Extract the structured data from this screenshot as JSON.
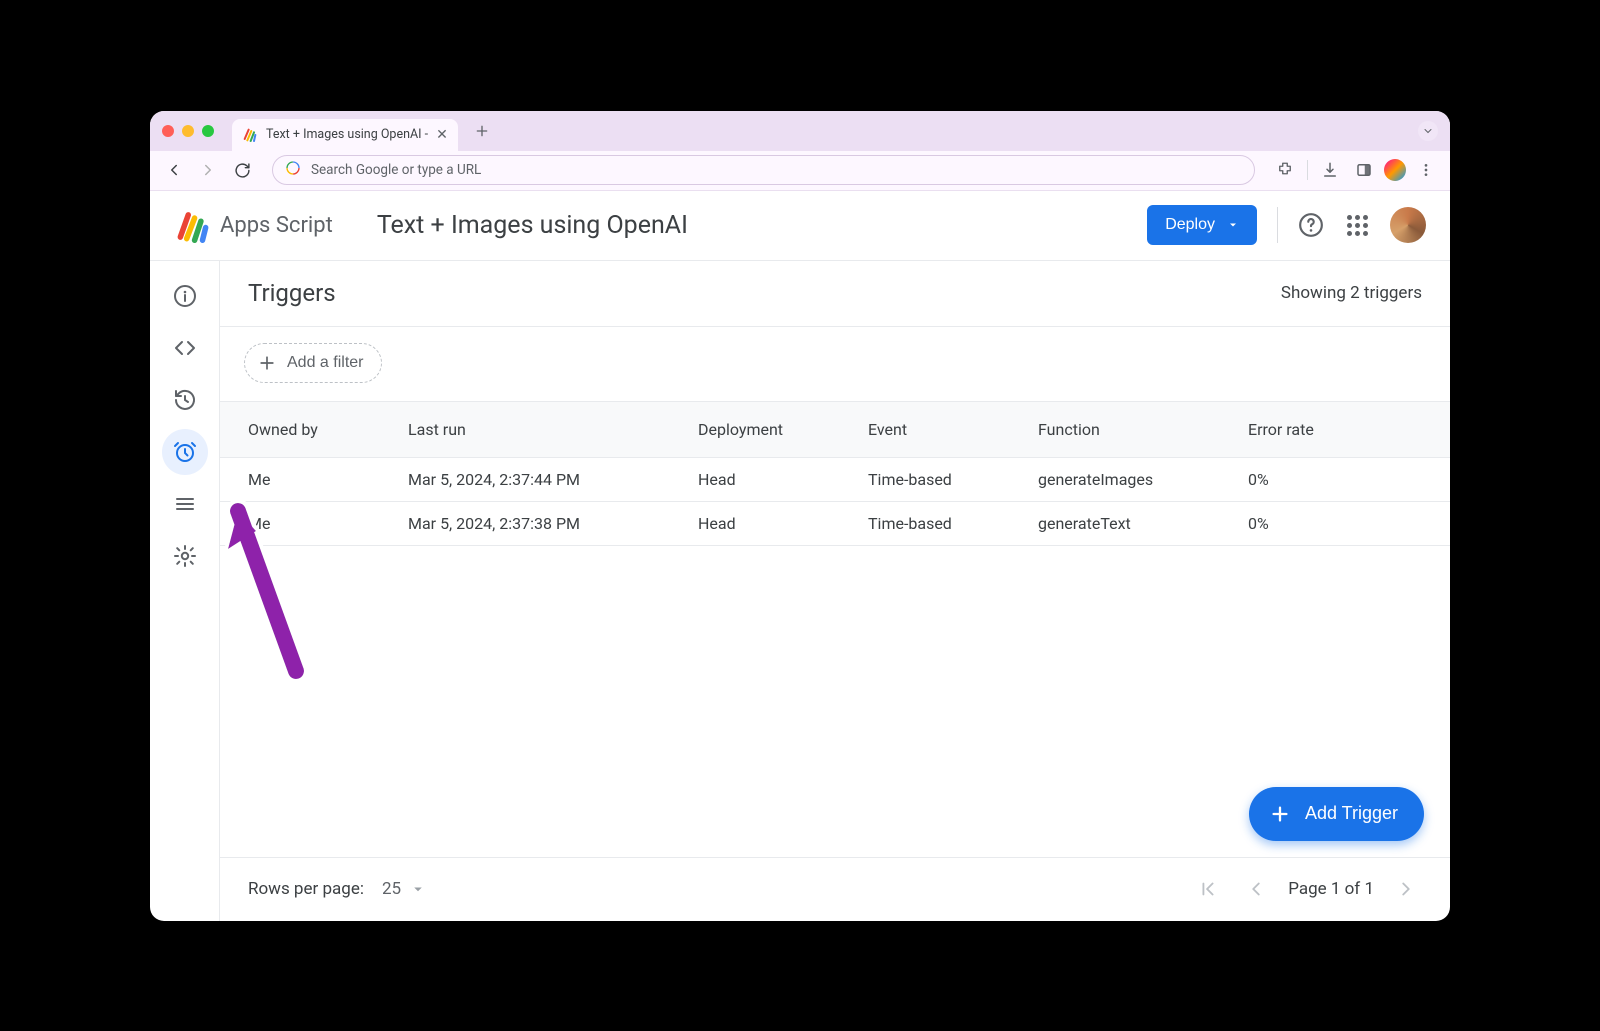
{
  "browser": {
    "tab_title": "Text + Images using OpenAI -",
    "omnibox_placeholder": "Search Google or type a URL"
  },
  "header": {
    "product": "Apps Script",
    "project_title": "Text + Images using OpenAI",
    "deploy_label": "Deploy"
  },
  "sidebar": {
    "items": [
      {
        "name": "overview",
        "icon": "info-icon"
      },
      {
        "name": "editor",
        "icon": "code-icon"
      },
      {
        "name": "executions",
        "icon": "history-icon"
      },
      {
        "name": "triggers",
        "icon": "alarm-icon",
        "active": true
      },
      {
        "name": "libraries",
        "icon": "list-icon"
      },
      {
        "name": "settings",
        "icon": "gear-icon"
      }
    ]
  },
  "page": {
    "title": "Triggers",
    "summary": "Showing 2 triggers",
    "add_filter_label": "Add a filter"
  },
  "table": {
    "columns": [
      "Owned by",
      "Last run",
      "Deployment",
      "Event",
      "Function",
      "Error rate"
    ],
    "rows": [
      {
        "owned_by": "Me",
        "last_run": "Mar 5, 2024, 2:37:44 PM",
        "deployment": "Head",
        "event": "Time-based",
        "function": "generateImages",
        "error_rate": "0%"
      },
      {
        "owned_by": "Me",
        "last_run": "Mar 5, 2024, 2:37:38 PM",
        "deployment": "Head",
        "event": "Time-based",
        "function": "generateText",
        "error_rate": "0%"
      }
    ]
  },
  "fab": {
    "label": "Add Trigger"
  },
  "pagination": {
    "rows_per_page_label": "Rows per page:",
    "rows_per_page_value": "25",
    "page_label": "Page 1 of 1"
  }
}
